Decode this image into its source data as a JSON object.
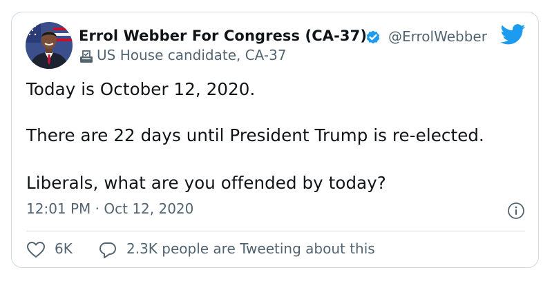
{
  "author": {
    "name": "Errol Webber For Congress (CA-37)",
    "handle": "@ErrolWebber",
    "bio_label": "US House candidate, CA-37"
  },
  "tweet": {
    "lines": [
      "Today is October 12, 2020.",
      "There are 22 days until President Trump is re-elected.",
      "Liberals, what are you offended by today?"
    ],
    "timestamp": "12:01 PM · Oct 12, 2020"
  },
  "engagement": {
    "likes": "6K",
    "conversation": "2.3K people are Tweeting about this"
  },
  "colors": {
    "brand_blue": "#1d9bf0",
    "secondary_text": "#536471",
    "border": "#cfd9de"
  },
  "icons": {
    "verified": "verified-badge-icon",
    "brand": "twitter-bird-icon",
    "label": "ballot-box-icon",
    "info": "info-icon",
    "like": "heart-icon",
    "reply": "reply-icon"
  }
}
